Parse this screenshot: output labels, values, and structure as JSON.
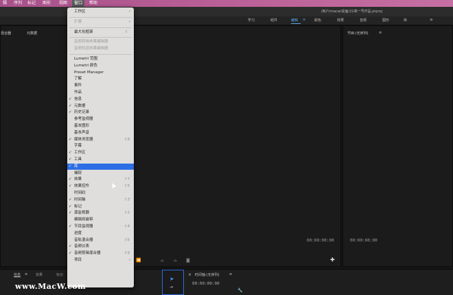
{
  "menubar": {
    "items": [
      "辑",
      "序列",
      "标记",
      "图形",
      "视图",
      "窗口",
      "帮助"
    ],
    "active_index": 5
  },
  "titlebar": {
    "path": "/用户/macw/桌面/21章一号作品.prproj"
  },
  "workspaces": {
    "tabs": [
      "学习",
      "组件",
      "编辑",
      "颜色",
      "效果",
      "音频",
      "图形",
      "库"
    ],
    "active": "编辑",
    "more_icon": "double-chevron-right-icon"
  },
  "source_panel": {
    "tab1": "混合器",
    "tab2": "元数据",
    "timecode": "00:00:00:00"
  },
  "program_panel": {
    "title": "节目:(无序列)",
    "menu_icon": "≡",
    "timecode": "00:00:00:00"
  },
  "window_menu": {
    "items": [
      {
        "label": "工作区",
        "submenu": true
      },
      {
        "sep": true
      },
      {
        "label": "扩展",
        "submenu": true,
        "disabled": true
      },
      {
        "sep": true
      },
      {
        "label": "最大化框架",
        "shortcut": "⇧`"
      },
      {
        "sep": true
      },
      {
        "label": "音频剪辑效果编辑器",
        "disabled": true
      },
      {
        "label": "音频轨道效果编辑器",
        "disabled": true
      },
      {
        "sep": true
      },
      {
        "label": "Lumetri 范围"
      },
      {
        "label": "Lumetri 颜色"
      },
      {
        "label": "Preset Manager"
      },
      {
        "label": "了解"
      },
      {
        "label": "事件"
      },
      {
        "label": "作品"
      },
      {
        "label": "信息",
        "checked": true
      },
      {
        "label": "元数据",
        "checked": true
      },
      {
        "label": "历史记录",
        "checked": true
      },
      {
        "label": "参考监视器"
      },
      {
        "label": "基本图形"
      },
      {
        "label": "基本声音"
      },
      {
        "label": "媒体浏览器",
        "checked": true,
        "shortcut": "⇧8"
      },
      {
        "label": "字幕"
      },
      {
        "label": "工作区",
        "checked": true
      },
      {
        "label": "工具",
        "checked": true
      },
      {
        "label": "库",
        "checked": true,
        "highlighted": true
      },
      {
        "label": "捕捉"
      },
      {
        "label": "效果",
        "checked": true,
        "shortcut": "⇧7"
      },
      {
        "label": "效果控件",
        "checked": true,
        "shortcut": "⇧5"
      },
      {
        "label": "时间码"
      },
      {
        "label": "时间轴",
        "checked": true,
        "shortcut": "⇧3"
      },
      {
        "label": "标记",
        "checked": true
      },
      {
        "label": "源监视器",
        "checked": true,
        "shortcut": "⇧2"
      },
      {
        "label": "编辑到磁带"
      },
      {
        "label": "节目监视器",
        "checked": true,
        "shortcut": "⇧4"
      },
      {
        "label": "进度"
      },
      {
        "label": "音轨混合器",
        "shortcut": "⇧6"
      },
      {
        "label": "音频仪表",
        "checked": true
      },
      {
        "label": "音频剪辑混合器",
        "checked": true,
        "shortcut": "⇧9"
      },
      {
        "label": "项目",
        "submenu": true
      }
    ]
  },
  "lower": {
    "tab_info": "信息",
    "tab_info_menu": "≡",
    "tab_effects": "效果",
    "tab_markers": "标记",
    "timeline_title": "时间轴:(无序列)",
    "timeline_menu": "≡",
    "timeline_tc": "00:00:00:00",
    "close_x": "×"
  },
  "watermark": "www.MacW.com",
  "colors": {
    "menubar": "#b85d94",
    "highlight": "#2d6ee5",
    "accent": "#55a8f0"
  }
}
